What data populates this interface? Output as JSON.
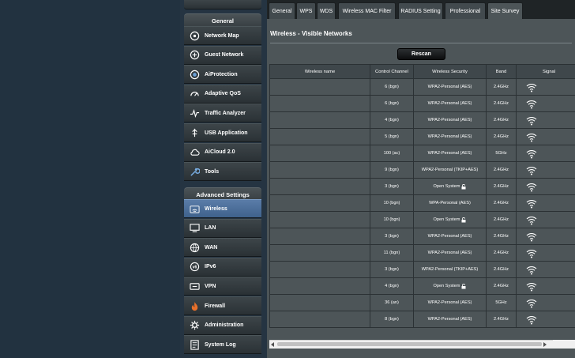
{
  "sidebar": {
    "general_header": "General",
    "general_items": [
      {
        "label": "Network Map",
        "icon": "network-map-icon"
      },
      {
        "label": "Guest Network",
        "icon": "guest-network-icon"
      },
      {
        "label": "AiProtection",
        "icon": "aiprotection-icon"
      },
      {
        "label": "Adaptive QoS",
        "icon": "adaptive-qos-icon"
      },
      {
        "label": "Traffic Analyzer",
        "icon": "traffic-analyzer-icon"
      },
      {
        "label": "USB Application",
        "icon": "usb-icon"
      },
      {
        "label": "AiCloud 2.0",
        "icon": "cloud-icon"
      },
      {
        "label": "Tools",
        "icon": "tools-icon"
      }
    ],
    "advanced_header": "Advanced Settings",
    "advanced_items": [
      {
        "label": "Wireless",
        "icon": "wireless-icon",
        "active": true
      },
      {
        "label": "LAN",
        "icon": "lan-icon"
      },
      {
        "label": "WAN",
        "icon": "wan-icon"
      },
      {
        "label": "IPv6",
        "icon": "ipv6-icon"
      },
      {
        "label": "VPN",
        "icon": "vpn-icon"
      },
      {
        "label": "Firewall",
        "icon": "firewall-icon"
      },
      {
        "label": "Administration",
        "icon": "administration-icon"
      },
      {
        "label": "System Log",
        "icon": "system-log-icon"
      }
    ]
  },
  "tabs": [
    "General",
    "WPS",
    "WDS",
    "Wireless MAC Filter",
    "RADIUS Setting",
    "Professional",
    "Site Survey"
  ],
  "active_tab": "Site Survey",
  "page_title": "Wireless - Visible Networks",
  "rescan_label": "Rescan",
  "table": {
    "headers": [
      "Wireless name",
      "Control Channel",
      "Wireless Security",
      "Band",
      "Signal"
    ],
    "rows": [
      {
        "name": "",
        "channel": "6 (bgn)",
        "security": "WPA2-Personal (AES)",
        "band": "2.4GHz",
        "locked": false
      },
      {
        "name": "",
        "channel": "6 (bgn)",
        "security": "WPA2-Personal (AES)",
        "band": "2.4GHz",
        "locked": false
      },
      {
        "name": "",
        "channel": "4 (bgn)",
        "security": "WPA2-Personal (AES)",
        "band": "2.4GHz",
        "locked": false
      },
      {
        "name": "",
        "channel": "5 (bgn)",
        "security": "WPA2-Personal (AES)",
        "band": "2.4GHz",
        "locked": false
      },
      {
        "name": "",
        "channel": "100 (ac)",
        "security": "WPA2-Personal (AES)",
        "band": "5GHz",
        "locked": false
      },
      {
        "name": "",
        "channel": "9 (bgn)",
        "security": "WPA2-Personal (TKIP+AES)",
        "band": "2.4GHz",
        "locked": false
      },
      {
        "name": "",
        "channel": "3 (bgn)",
        "security": "Open System",
        "band": "2.4GHz",
        "locked": true
      },
      {
        "name": "",
        "channel": "10 (bgn)",
        "security": "WPA-Personal (AES)",
        "band": "2.4GHz",
        "locked": false
      },
      {
        "name": "",
        "channel": "10 (bgn)",
        "security": "Open System",
        "band": "2.4GHz",
        "locked": true
      },
      {
        "name": "",
        "channel": "3 (bgn)",
        "security": "WPA2-Personal (AES)",
        "band": "2.4GHz",
        "locked": false
      },
      {
        "name": "",
        "channel": "11 (bgn)",
        "security": "WPA2-Personal (AES)",
        "band": "2.4GHz",
        "locked": false
      },
      {
        "name": "",
        "channel": "3 (bgn)",
        "security": "WPA2-Personal (TKIP+AES)",
        "band": "2.4GHz",
        "locked": false
      },
      {
        "name": "",
        "channel": "4 (bgn)",
        "security": "Open System",
        "band": "2.4GHz",
        "locked": true
      },
      {
        "name": "",
        "channel": "36 (an)",
        "security": "WPA2-Personal (AES)",
        "band": "5GHz",
        "locked": false
      },
      {
        "name": "",
        "channel": "8 (bgn)",
        "security": "WPA2-Personal (AES)",
        "band": "2.4GHz",
        "locked": false
      }
    ]
  },
  "colors": {
    "accent": "#4f75a3",
    "panel": "#4d5558",
    "background": "#253442"
  }
}
